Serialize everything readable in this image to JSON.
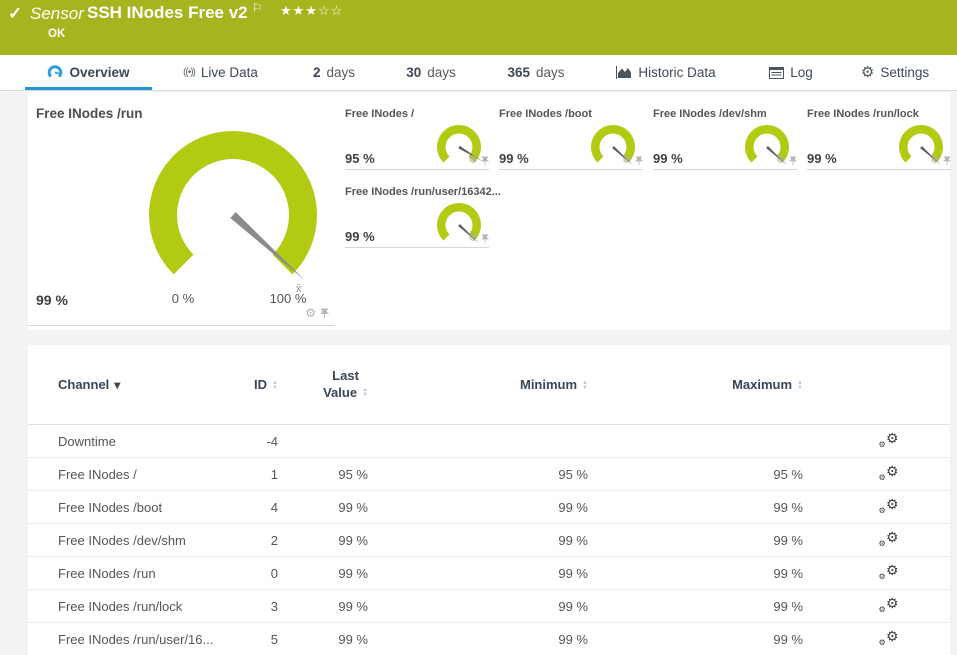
{
  "header": {
    "check": "✓",
    "sensor_label": "Sensor",
    "title": "SSH INodes Free v2",
    "flag": "⚐",
    "stars": "★★★☆☆",
    "status": "OK"
  },
  "tabs": [
    {
      "label": "Overview",
      "active": true
    },
    {
      "label": "Live Data"
    },
    {
      "number": "2",
      "label": "days"
    },
    {
      "number": "30",
      "label": "days"
    },
    {
      "number": "365",
      "label": "days"
    },
    {
      "label": "Historic Data"
    },
    {
      "label": "Log"
    },
    {
      "label": "Settings"
    }
  ],
  "icons": {
    "gear": "⚙",
    "broadcast": "((•))",
    "caret_down": "▾",
    "sort_up": "▲",
    "sort_down": "▼"
  },
  "gauges": {
    "primary": {
      "title": "Free INodes /run",
      "value": 99,
      "value_label": "99 %",
      "min_label": "0 %",
      "max_label": "100 %",
      "avg_marker": "x̄"
    },
    "small": [
      {
        "title": "Free INodes /",
        "value": 95,
        "value_label": "95 %"
      },
      {
        "title": "Free INodes /boot",
        "value": 99,
        "value_label": "99 %"
      },
      {
        "title": "Free INodes /dev/shm",
        "value": 99,
        "value_label": "99 %"
      },
      {
        "title": "Free INodes /run/lock",
        "value": 99,
        "value_label": "99 %"
      },
      {
        "title": "Free INodes /run/user/16342...",
        "value": 99,
        "value_label": "99 %"
      }
    ]
  },
  "table": {
    "columns": [
      {
        "label": "Channel",
        "sorted": true
      },
      {
        "label": "ID"
      },
      {
        "label": "Last Value",
        "line1": "Last",
        "line2": "Value"
      },
      {
        "label": "Minimum"
      },
      {
        "label": "Maximum"
      }
    ],
    "rows": [
      {
        "channel": "Downtime",
        "id": "-4",
        "last": "",
        "min": "",
        "max": ""
      },
      {
        "channel": "Free INodes /",
        "id": "1",
        "last": "95 %",
        "min": "95 %",
        "max": "95 %"
      },
      {
        "channel": "Free INodes /boot",
        "id": "4",
        "last": "99 %",
        "min": "99 %",
        "max": "99 %"
      },
      {
        "channel": "Free INodes /dev/shm",
        "id": "2",
        "last": "99 %",
        "min": "99 %",
        "max": "99 %"
      },
      {
        "channel": "Free INodes /run",
        "id": "0",
        "last": "99 %",
        "min": "99 %",
        "max": "99 %"
      },
      {
        "channel": "Free INodes /run/lock",
        "id": "3",
        "last": "99 %",
        "min": "99 %",
        "max": "99 %"
      },
      {
        "channel": "Free INodes /run/user/16...",
        "id": "5",
        "last": "99 %",
        "min": "99 %",
        "max": "99 %"
      }
    ]
  },
  "colors": {
    "brand_green": "#a6b41f",
    "gauge_green": "#b2ca11",
    "accent_blue": "#2196d3",
    "header_text": "#384658"
  }
}
